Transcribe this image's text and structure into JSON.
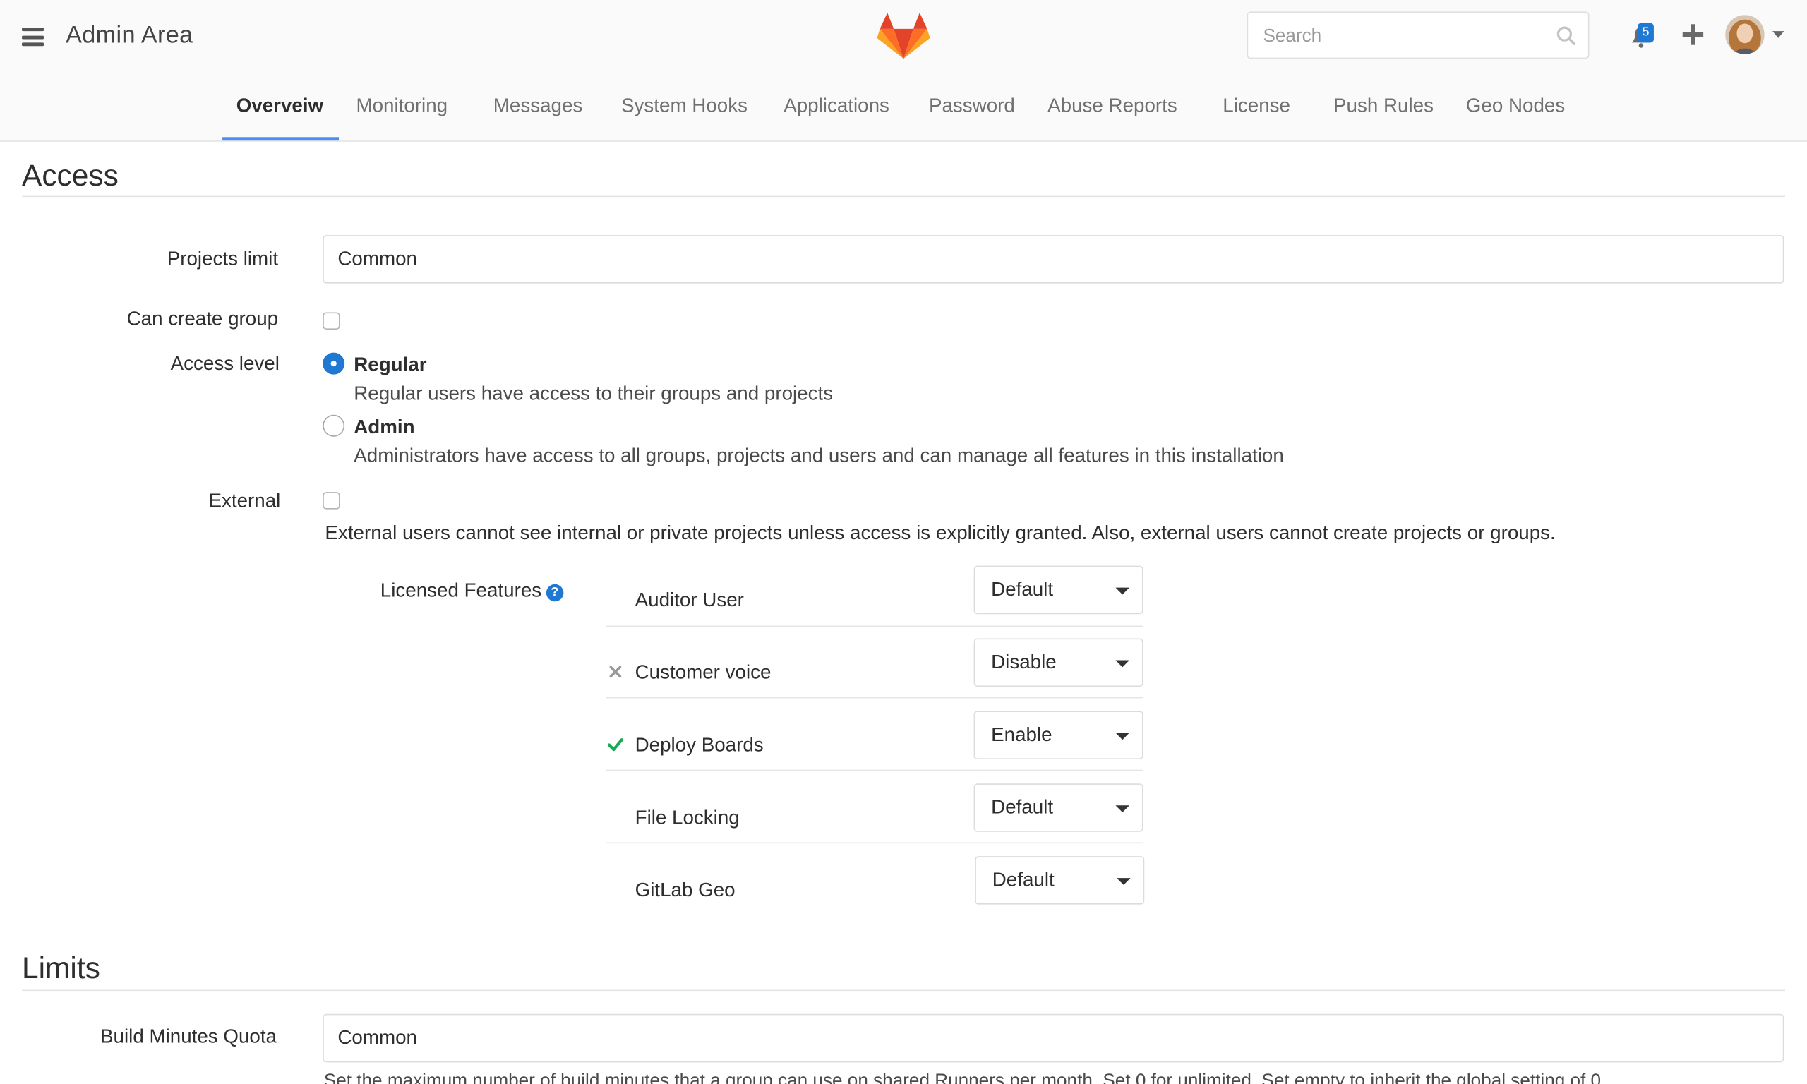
{
  "header": {
    "title": "Admin Area",
    "search_placeholder": "Search",
    "notification_count": "5"
  },
  "tabs": [
    {
      "label": "Overveiw",
      "active": true
    },
    {
      "label": "Monitoring"
    },
    {
      "label": "Messages"
    },
    {
      "label": "System Hooks"
    },
    {
      "label": "Applications"
    },
    {
      "label": "Password"
    },
    {
      "label": "Abuse Reports"
    },
    {
      "label": "License"
    },
    {
      "label": "Push Rules"
    },
    {
      "label": "Geo Nodes"
    }
  ],
  "access": {
    "title": "Access",
    "projects_limit_label": "Projects limit",
    "projects_limit_value": "Common",
    "can_create_group_label": "Can create group",
    "access_level_label": "Access level",
    "regular_title": "Regular",
    "regular_help": "Regular users have access to their groups and projects",
    "admin_title": "Admin",
    "admin_help": "Administrators have access to all groups, projects and users and can manage all features in this installation",
    "selected_level": "Regular",
    "external_label": "External",
    "external_help": "External users cannot see internal or private projects unless access is explicitly granted. Also, external users cannot create projects or groups."
  },
  "licensed_features": {
    "label": "Licensed Features",
    "items": [
      {
        "name": "Auditor User",
        "value": "Default",
        "status": "none"
      },
      {
        "name": "Customer voice",
        "value": "Disable",
        "status": "disabled"
      },
      {
        "name": "Deploy Boards",
        "value": "Enable",
        "status": "enabled"
      },
      {
        "name": "File Locking",
        "value": "Default",
        "status": "none"
      },
      {
        "name": "GitLab Geo",
        "value": "Default",
        "status": "none"
      }
    ]
  },
  "limits": {
    "title": "Limits",
    "build_minutes_label": "Build Minutes Quota",
    "build_minutes_value": "Common",
    "build_minutes_help": "Set the maximum number of build minutes that a group can use on shared Runners per month. Set 0 for unlimited. Set empty to inherit the global setting of 0"
  },
  "colors": {
    "accent": "#1f78d1",
    "tab_underline": "#4a8bee",
    "success": "#1aaa55",
    "muted_icon": "#999999"
  }
}
